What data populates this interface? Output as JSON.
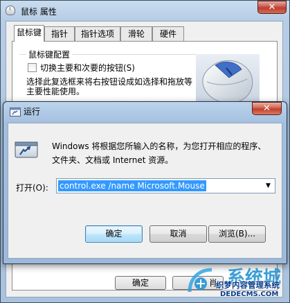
{
  "mouse_properties": {
    "title": "鼠标 属性",
    "close_glyph": "✕",
    "tabs": [
      {
        "label": "鼠标键",
        "active": true
      },
      {
        "label": "指针",
        "active": false
      },
      {
        "label": "指针选项",
        "active": false
      },
      {
        "label": "滑轮",
        "active": false
      },
      {
        "label": "硬件",
        "active": false
      }
    ],
    "group_title": "鼠标键配置",
    "swap_buttons_label": "切换主要和次要的按钮(S)",
    "swap_buttons_checked": false,
    "description": "选择此复选框来将右按钮设成如选择和拖放等主要性能使用。",
    "ok_label": "确定",
    "partial_button_label": "肖"
  },
  "run_dialog": {
    "title": "运行",
    "close_glyph": "✕",
    "description": "Windows 将根据您所输入的名称，为您打开相应的程序、文件夹、文档或 Internet 资源。",
    "open_label": "打开(O):",
    "command_value": "control.exe /name Microsoft.Mouse",
    "dropdown_glyph": "▼",
    "ok_label": "确定",
    "cancel_label": "取消",
    "browse_label": "浏览(B)..."
  },
  "watermark": {
    "big_text": "系统城",
    "line_text": "织梦内容管理系统",
    "url_text": "DEDECMS.COM",
    "colors": {
      "blue": "#1a8fd0",
      "navy": "#0a3d8a"
    }
  }
}
